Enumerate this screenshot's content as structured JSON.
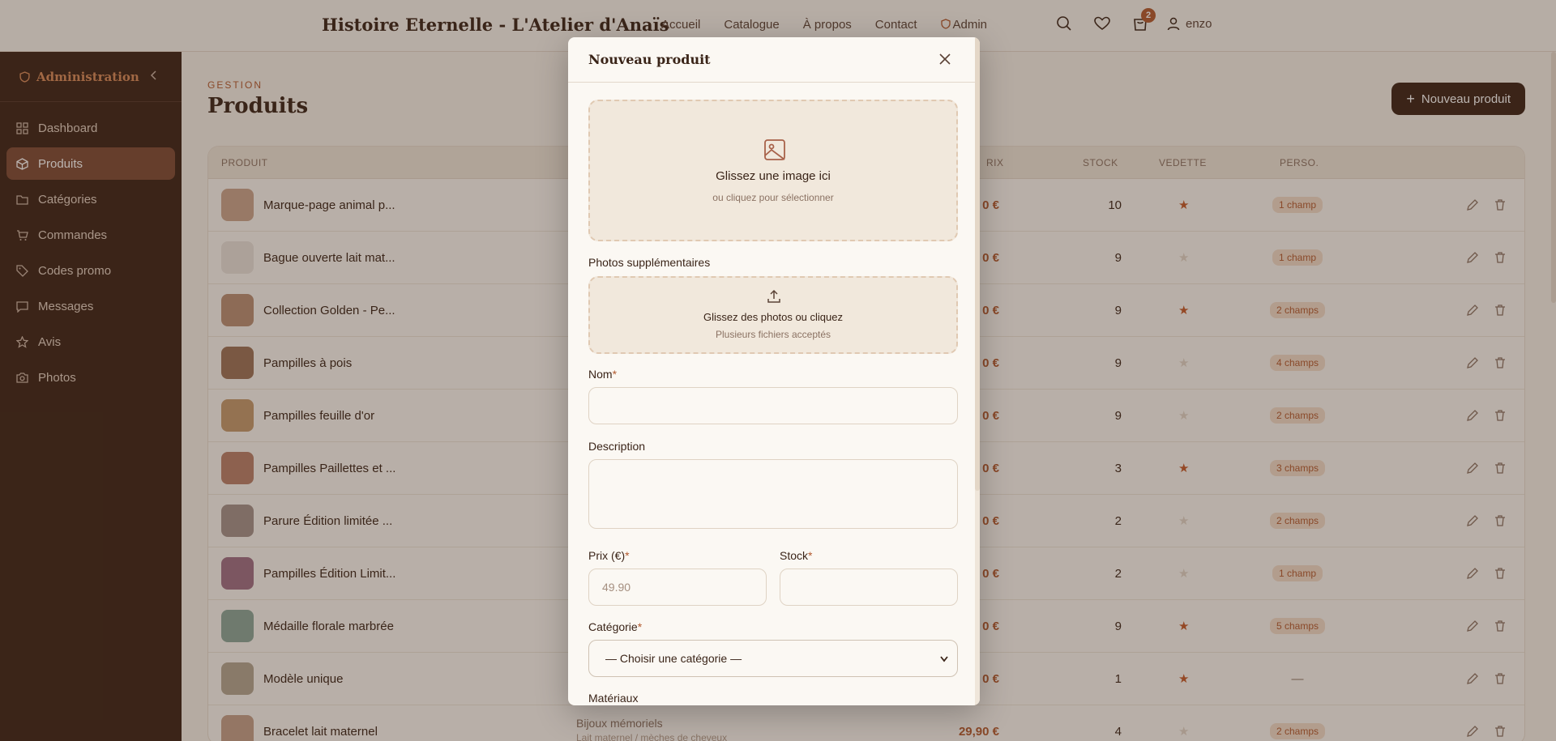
{
  "topnav": {
    "brand": "Histoire Eternelle - L'Atelier d'Anaïs",
    "links": [
      "Accueil",
      "Catalogue",
      "À propos",
      "Contact"
    ],
    "admin_label": "Admin",
    "cart_count": "2",
    "user_name": "enzo"
  },
  "sidebar": {
    "title": "Administration",
    "items": [
      {
        "label": "Dashboard",
        "icon": "dashboard-icon"
      },
      {
        "label": "Produits",
        "icon": "box-icon"
      },
      {
        "label": "Catégories",
        "icon": "folder-icon"
      },
      {
        "label": "Commandes",
        "icon": "cart-icon"
      },
      {
        "label": "Codes promo",
        "icon": "tag-icon"
      },
      {
        "label": "Messages",
        "icon": "message-icon"
      },
      {
        "label": "Avis",
        "icon": "star-icon"
      },
      {
        "label": "Photos",
        "icon": "camera-icon"
      }
    ]
  },
  "main": {
    "eyebrow": "GESTION",
    "title": "Produits",
    "new_button": "Nouveau produit",
    "columns": {
      "product": "PRODUIT",
      "price": "RIX",
      "stock": "STOCK",
      "featured": "VEDETTE",
      "custom": "PERSO."
    },
    "rows": [
      {
        "name": "Marque-page animal p...",
        "category": "",
        "price": "0 €",
        "stock": "10",
        "featured": true,
        "custom": "1 champ"
      },
      {
        "name": "Bague ouverte lait mat...",
        "category": "",
        "price": "0 €",
        "stock": "9",
        "featured": false,
        "custom": "1 champ"
      },
      {
        "name": "Collection Golden - Pe...",
        "category": "",
        "price": "0 €",
        "stock": "9",
        "featured": true,
        "custom": "2 champs"
      },
      {
        "name": "Pampilles à pois",
        "category": "",
        "price": "0 €",
        "stock": "9",
        "featured": false,
        "custom": "4 champs"
      },
      {
        "name": "Pampilles feuille d'or",
        "category": "",
        "price": "0 €",
        "stock": "9",
        "featured": false,
        "custom": "2 champs"
      },
      {
        "name": "Pampilles Paillettes et ...",
        "category": "",
        "price": "0 €",
        "stock": "3",
        "featured": true,
        "custom": "3 champs"
      },
      {
        "name": "Parure Édition limitée ...",
        "category": "",
        "price": "0 €",
        "stock": "2",
        "featured": false,
        "custom": "2 champs"
      },
      {
        "name": "Pampilles Édition Limit...",
        "category": "",
        "price": "0 €",
        "stock": "2",
        "featured": false,
        "custom": "1 champ"
      },
      {
        "name": "Médaille florale marbrée",
        "category": "",
        "price": "0 €",
        "stock": "9",
        "featured": true,
        "custom": "5 champs"
      },
      {
        "name": "Modèle unique",
        "category": "",
        "price": "0 €",
        "stock": "1",
        "featured": true,
        "custom": "—"
      },
      {
        "name": "Bracelet lait maternel",
        "category": "Bijoux mémoriels",
        "category_sub": "Lait maternel / mèches de cheveux",
        "price": "29,90 €",
        "stock": "4",
        "featured": false,
        "custom": "2 champs"
      }
    ]
  },
  "modal": {
    "title": "Nouveau produit",
    "main_drop": {
      "title": "Glissez une image ici",
      "subtitle": "ou cliquez pour sélectionner"
    },
    "extra_label": "Photos supplémentaires",
    "extra_drop": {
      "title": "Glissez des photos ou cliquez",
      "subtitle": "Plusieurs fichiers acceptés"
    },
    "name_label": "Nom",
    "description_label": "Description",
    "price_label": "Prix (€)",
    "price_placeholder": "49.90",
    "stock_label": "Stock",
    "category_label": "Catégorie",
    "category_selected": "— Choisir une catégorie —",
    "materials_label": "Matériaux",
    "required_mark": "*"
  },
  "colors": {
    "accent": "#b25a2f",
    "sidebar": "#3b2316",
    "background": "#f6f1ea"
  }
}
